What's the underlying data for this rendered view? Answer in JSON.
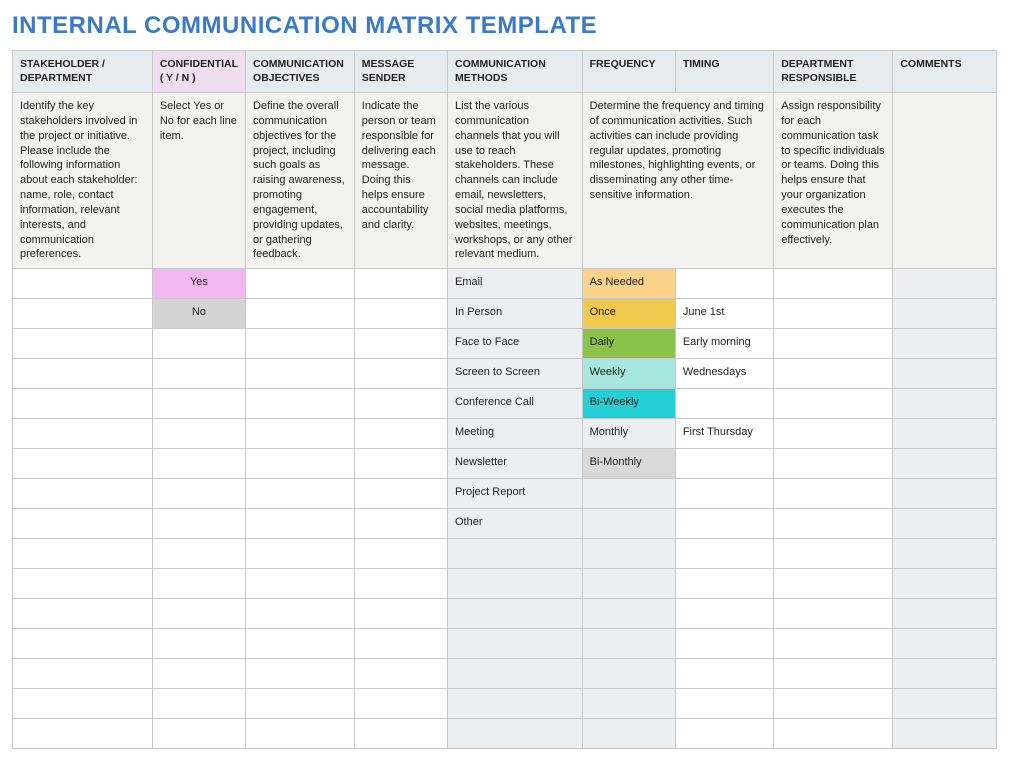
{
  "title": "INTERNAL COMMUNICATION MATRIX TEMPLATE",
  "headers": [
    "STAKEHOLDER / DEPARTMENT",
    "CONFIDENTIAL ( Y / N )",
    "COMMUNICATION OBJECTIVES",
    "MESSAGE SENDER",
    "COMMUNICATION METHODS",
    "FREQUENCY",
    "TIMING",
    "DEPARTMENT RESPONSIBLE",
    "COMMENTS"
  ],
  "descriptions": {
    "stakeholder": "Identify the key stakeholders involved in the project or initiative. Please include the following information about each stakeholder: name, role, contact information, relevant interests, and communication preferences.",
    "confidential": "Select Yes or No for each line item.",
    "objectives": "Define the overall communication objectives for the project, including such goals as raising awareness, promoting engagement, providing updates, or gathering feedback.",
    "sender": "Indicate the person or team responsible for delivering each message. Doing this helps ensure accountability and clarity.",
    "methods": "List the various communication channels that you will use to reach stakeholders. These channels can include email, newsletters, social media platforms, websites, meetings, workshops, or any other relevant medium.",
    "freq_timing": "Determine the frequency and timing of communication activities. Such activities can include providing regular updates, promoting milestones, highlighting events, or disseminating any other time-sensitive information.",
    "responsible": "Assign responsibility for each communication task to specific individuals or teams. Doing this helps ensure that your organization executes the communication plan effectively.",
    "comments": ""
  },
  "rows": [
    {
      "stakeholder": "",
      "confidential": "Yes",
      "confClass": "c-pink",
      "objectives": "",
      "sender": "",
      "methods": "Email",
      "frequency": "As Needed",
      "freqClass": "c-orange",
      "timing": "",
      "responsible": "",
      "comments": ""
    },
    {
      "stakeholder": "",
      "confidential": "No",
      "confClass": "c-grey",
      "objectives": "",
      "sender": "",
      "methods": "In Person",
      "frequency": "Once",
      "freqClass": "c-yellow",
      "timing": "June 1st",
      "responsible": "",
      "comments": ""
    },
    {
      "stakeholder": "",
      "confidential": "",
      "confClass": "",
      "objectives": "",
      "sender": "",
      "methods": "Face to Face",
      "frequency": "Daily",
      "freqClass": "c-green",
      "timing": "Early morning",
      "responsible": "",
      "comments": ""
    },
    {
      "stakeholder": "",
      "confidential": "",
      "confClass": "",
      "objectives": "",
      "sender": "",
      "methods": "Screen to Screen",
      "frequency": "Weekly",
      "freqClass": "c-mint",
      "timing": "Wednesdays",
      "responsible": "",
      "comments": ""
    },
    {
      "stakeholder": "",
      "confidential": "",
      "confClass": "",
      "objectives": "",
      "sender": "",
      "methods": "Conference Call",
      "frequency": "Bi-Weekly",
      "freqClass": "c-cyan",
      "timing": "",
      "responsible": "",
      "comments": ""
    },
    {
      "stakeholder": "",
      "confidential": "",
      "confClass": "",
      "objectives": "",
      "sender": "",
      "methods": "Meeting",
      "frequency": "Monthly",
      "freqClass": "",
      "timing": "First Thursday",
      "responsible": "",
      "comments": ""
    },
    {
      "stakeholder": "",
      "confidential": "",
      "confClass": "",
      "objectives": "",
      "sender": "",
      "methods": "Newsletter",
      "frequency": "Bi-Monthly",
      "freqClass": "c-silver",
      "timing": "",
      "responsible": "",
      "comments": ""
    },
    {
      "stakeholder": "",
      "confidential": "",
      "confClass": "",
      "objectives": "",
      "sender": "",
      "methods": "Project Report",
      "frequency": "",
      "freqClass": "",
      "timing": "",
      "responsible": "",
      "comments": ""
    },
    {
      "stakeholder": "",
      "confidential": "",
      "confClass": "",
      "objectives": "",
      "sender": "",
      "methods": "Other",
      "frequency": "",
      "freqClass": "",
      "timing": "",
      "responsible": "",
      "comments": ""
    },
    {
      "stakeholder": "",
      "confidential": "",
      "confClass": "",
      "objectives": "",
      "sender": "",
      "methods": "",
      "frequency": "",
      "freqClass": "",
      "timing": "",
      "responsible": "",
      "comments": ""
    },
    {
      "stakeholder": "",
      "confidential": "",
      "confClass": "",
      "objectives": "",
      "sender": "",
      "methods": "",
      "frequency": "",
      "freqClass": "",
      "timing": "",
      "responsible": "",
      "comments": ""
    },
    {
      "stakeholder": "",
      "confidential": "",
      "confClass": "",
      "objectives": "",
      "sender": "",
      "methods": "",
      "frequency": "",
      "freqClass": "",
      "timing": "",
      "responsible": "",
      "comments": ""
    },
    {
      "stakeholder": "",
      "confidential": "",
      "confClass": "",
      "objectives": "",
      "sender": "",
      "methods": "",
      "frequency": "",
      "freqClass": "",
      "timing": "",
      "responsible": "",
      "comments": ""
    },
    {
      "stakeholder": "",
      "confidential": "",
      "confClass": "",
      "objectives": "",
      "sender": "",
      "methods": "",
      "frequency": "",
      "freqClass": "",
      "timing": "",
      "responsible": "",
      "comments": ""
    },
    {
      "stakeholder": "",
      "confidential": "",
      "confClass": "",
      "objectives": "",
      "sender": "",
      "methods": "",
      "frequency": "",
      "freqClass": "",
      "timing": "",
      "responsible": "",
      "comments": ""
    },
    {
      "stakeholder": "",
      "confidential": "",
      "confClass": "",
      "objectives": "",
      "sender": "",
      "methods": "",
      "frequency": "",
      "freqClass": "",
      "timing": "",
      "responsible": "",
      "comments": ""
    }
  ]
}
